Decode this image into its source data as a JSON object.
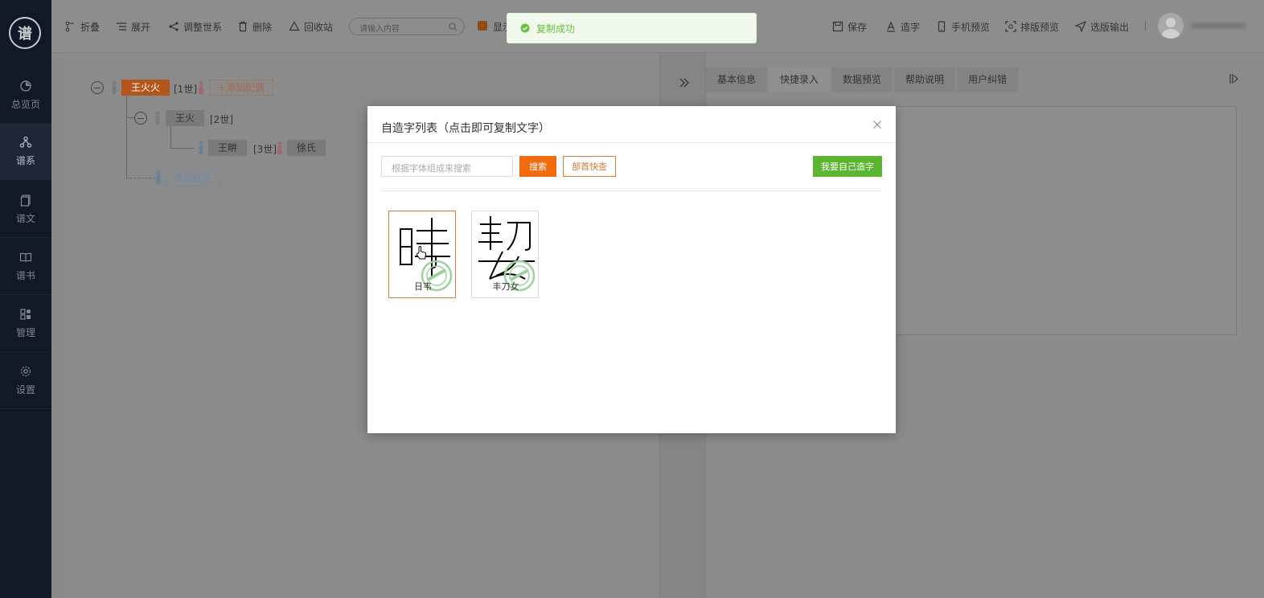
{
  "app": {
    "logo_text": "谱"
  },
  "sidebar": {
    "items": [
      {
        "label": "总览页",
        "icon": "pie-chart-icon"
      },
      {
        "label": "谱系",
        "icon": "tree-icon",
        "active": true
      },
      {
        "label": "谱文",
        "icon": "document-icon"
      },
      {
        "label": "谱书",
        "icon": "book-icon"
      },
      {
        "label": "管理",
        "icon": "grid-icon"
      },
      {
        "label": "设置",
        "icon": "gear-icon"
      }
    ]
  },
  "toolbar": {
    "collapse_label": "折叠",
    "expand_label": "展开",
    "adjust_label": "调整世系",
    "delete_label": "删除",
    "recycle_label": "回收站",
    "search_placeholder": "请输入内容",
    "show_label": "显示",
    "save_label": "保存",
    "create_char_label": "造字",
    "mobile_preview_label": "手机预览",
    "layout_preview_label": "排版预览",
    "export_label": "选版输出"
  },
  "tree": {
    "root": {
      "name": "王火火",
      "gen": "[1世]",
      "add_spouse": "+添加配偶"
    },
    "child": {
      "name": "王火",
      "gen": "[2世]"
    },
    "grandchild": {
      "name": "王畊",
      "gen": "[3世]",
      "spouse": "徐氏"
    },
    "add_child": "添加孩子"
  },
  "right_panel": {
    "tabs": [
      "基本信息",
      "快捷录入",
      "数据预览",
      "帮助说明",
      "用户纠错"
    ],
    "active_tab": 1
  },
  "toast": {
    "message": "复制成功",
    "color": "#67c23a"
  },
  "modal": {
    "title": "自造字列表（点击即可复制文字）",
    "search_placeholder": "根据字体组成来搜索",
    "search_button": "搜索",
    "radical_button": "部首快查",
    "create_button": "我要自己造字",
    "characters": [
      {
        "glyph_parts": "日韦",
        "label": "日韦",
        "selected": true
      },
      {
        "glyph_parts": "丰刀女",
        "label": "丰刀女",
        "selected": false
      }
    ]
  },
  "colors": {
    "accent": "#f26c0d",
    "green": "#5cb531",
    "sidebar": "#111826"
  }
}
